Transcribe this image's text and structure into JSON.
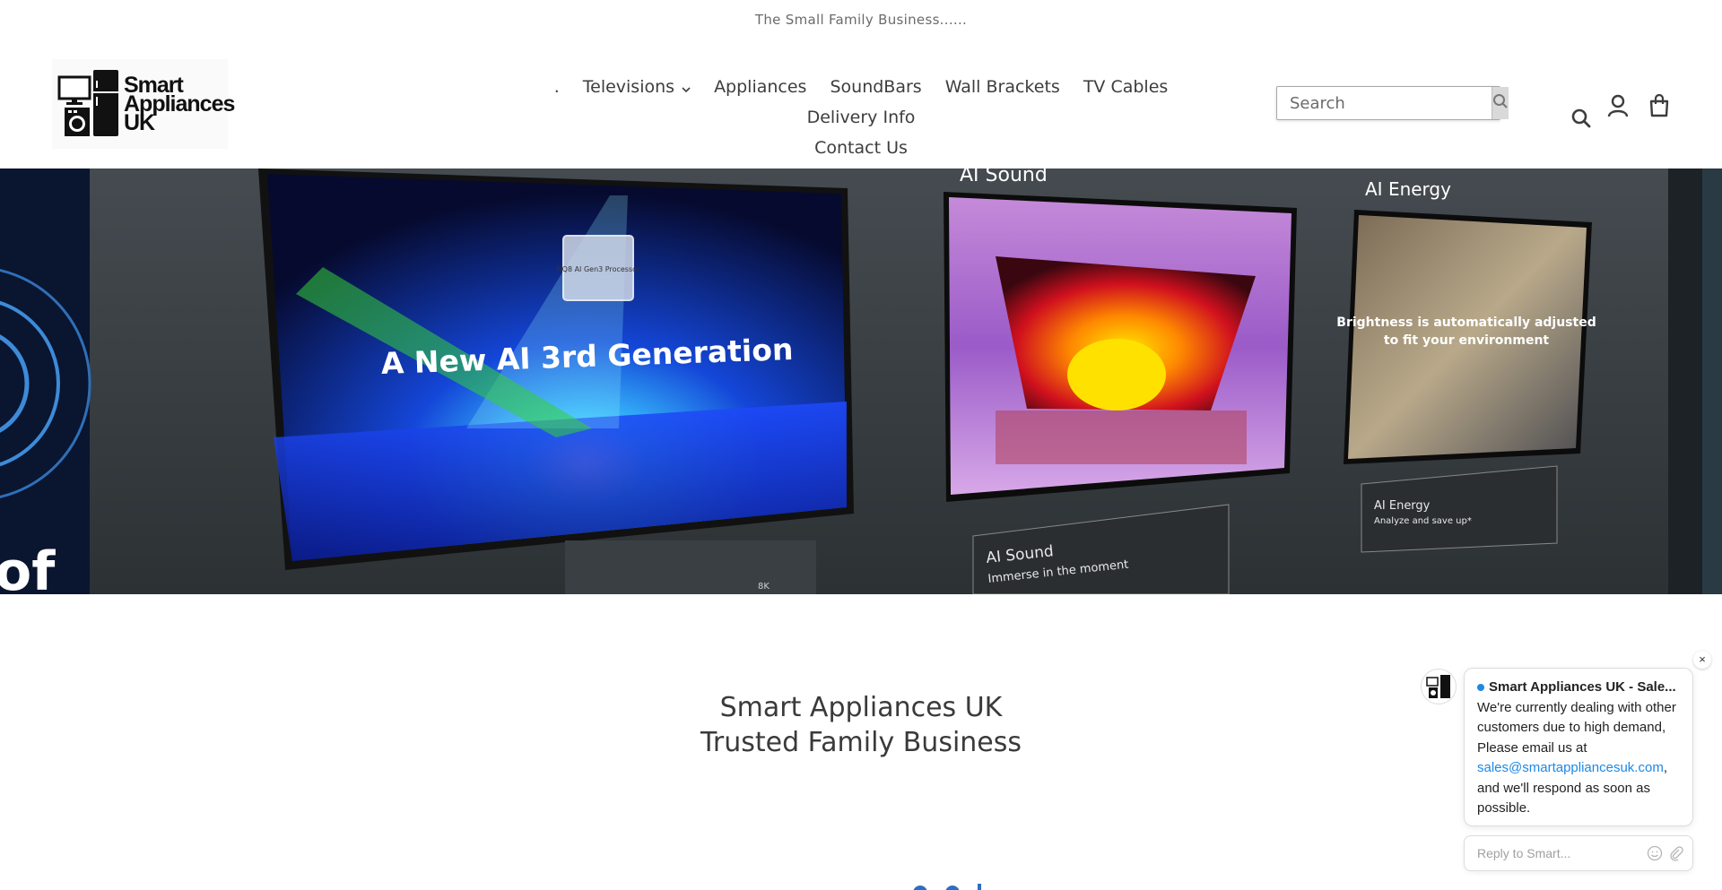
{
  "announcement": {
    "text": "The Small Family Business......"
  },
  "logo": {
    "line1": "Smart",
    "line2": "Appliances",
    "line3": "UK"
  },
  "nav": {
    "items": [
      {
        "label": ".",
        "has_dropdown": false
      },
      {
        "label": "Televisions",
        "has_dropdown": true
      },
      {
        "label": "Appliances",
        "has_dropdown": false
      },
      {
        "label": "SoundBars",
        "has_dropdown": false
      },
      {
        "label": "Wall Brackets",
        "has_dropdown": false
      },
      {
        "label": "TV Cables",
        "has_dropdown": false
      },
      {
        "label": "Delivery Info",
        "has_dropdown": false
      },
      {
        "label": "Contact Us",
        "has_dropdown": false
      }
    ]
  },
  "search": {
    "placeholder": "Search",
    "value": ""
  },
  "header_icons": [
    "search-icon",
    "account-icon",
    "cart-icon"
  ],
  "hero": {
    "screen1_text": "A New AI 3rd Generation",
    "screen2_label": "AI Sound",
    "screen3_label": "AI Energy",
    "screen3_text_line1": "Brightness is automatically adjusted",
    "screen3_text_line2": "to fit your environment",
    "card1_line1": "AI Sound",
    "card1_line2": "Immerse in the moment",
    "card2_line1": "AI Energy",
    "card2_line2": "Analyze and save up*",
    "left_edge_text": "of",
    "badge": "8K",
    "chip_text": "NQ8 AI Gen3 Processor"
  },
  "intro": {
    "line1": "Smart Appliances UK",
    "line2": "Trusted Family Business"
  },
  "chat": {
    "close_label": "×",
    "title": "Smart Appliances UK - Sale...",
    "message_before_link": "We're currently dealing with other customers due to high demand, Please email us at",
    "link": "sales@smartappliancesuk.com",
    "message_after_link": ", and we'll respond as soon as possible.",
    "reply_placeholder": "Reply to Smart..."
  },
  "colors": {
    "accent_blue": "#1e88e5",
    "nav_text": "#3d3d3d",
    "search_button_bg": "#d9d9d9"
  }
}
